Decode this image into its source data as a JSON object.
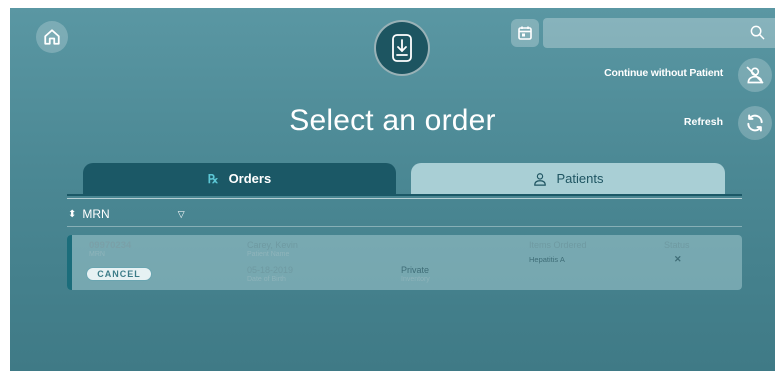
{
  "header": {
    "search": {
      "placeholder": "",
      "value": ""
    },
    "continue_label": "Continue without Patient",
    "refresh_label": "Refresh"
  },
  "page": {
    "title": "Select an order"
  },
  "tabs": [
    {
      "label": "Orders",
      "active": true,
      "icon": "rx-icon"
    },
    {
      "label": "Patients",
      "active": false,
      "icon": "person-icon"
    }
  ],
  "sort": {
    "label": "MRN"
  },
  "orders": [
    {
      "mrn": "09970234",
      "mrn_label": "MRN",
      "patient_name": "Carey, Kevin",
      "patient_name_label": "Patient Name",
      "dob": "05-18-2019",
      "dob_label": "Date of Birth",
      "inventory": "Private",
      "inventory_label": "Inventory",
      "items_label": "Items Ordered",
      "items_value": "Hepatitis A",
      "status_label": "Status",
      "status_value": "✕",
      "cancel_label": "CANCEL"
    }
  ],
  "colors": {
    "background": "#4b8894",
    "active_tab": "#1b5866",
    "inactive_tab": "#a9cfd5",
    "badge": "#1d5561"
  }
}
